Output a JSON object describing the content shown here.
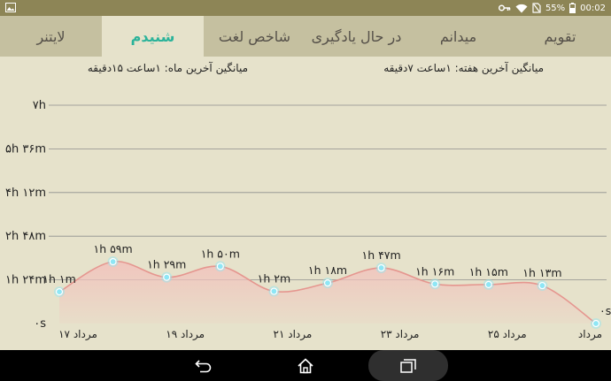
{
  "status_bar": {
    "battery": "55%",
    "time": "00:02",
    "icons": [
      "picture-icon",
      "key-icon",
      "wifi-icon",
      "no-sim-icon",
      "battery-icon"
    ]
  },
  "tabs": [
    {
      "label": "تقویم",
      "active": false
    },
    {
      "label": "میدانم",
      "active": false
    },
    {
      "label": "در حال یادگیری",
      "active": false
    },
    {
      "label": "شاخص لغت",
      "active": false
    },
    {
      "label": "شنیدم",
      "active": true
    },
    {
      "label": "لایتنر",
      "active": false
    }
  ],
  "stats": {
    "weekly_avg": "میانگین آخرین هفته: ۱ساعت  ۷دقیقه",
    "monthly_avg": "میانگین آخرین ماه: ۱ساعت  ۱۵دقیقه"
  },
  "chart_data": {
    "type": "area",
    "y_tick_labels": [
      "۰s",
      "۱h ۲۴m",
      "۲h ۴۸m",
      "۴h ۱۲m",
      "۵h ۳۶m",
      "۷h"
    ],
    "y_tick_values_minutes": [
      0,
      84,
      168,
      252,
      336,
      420
    ],
    "ylim_minutes": [
      0,
      420
    ],
    "x_tick_labels": [
      "۱۷ مرداد",
      "۱۹ مرداد",
      "۲۱ مرداد",
      "۲۳ مرداد",
      "۲۵ مرداد",
      "مرداد"
    ],
    "x_tick_indices": [
      0,
      2,
      4,
      6,
      8,
      10
    ],
    "points": [
      {
        "label": "۱h ۱m",
        "minutes": 61
      },
      {
        "label": "۱h ۵۹m",
        "minutes": 119
      },
      {
        "label": "۱h ۲۹m",
        "minutes": 89
      },
      {
        "label": "۱h ۵۰m",
        "minutes": 110
      },
      {
        "label": "۱h ۲m",
        "minutes": 62
      },
      {
        "label": "۱h ۱۸m",
        "minutes": 78
      },
      {
        "label": "۱h ۴۷m",
        "minutes": 107
      },
      {
        "label": "۱h ۱۶m",
        "minutes": 76
      },
      {
        "label": "۱h ۱۵m",
        "minutes": 75
      },
      {
        "label": "۱h ۱۳m",
        "minutes": 73
      },
      {
        "label": "۰s",
        "minutes": 0
      }
    ],
    "grid": true,
    "colors": {
      "line": "#e5968f",
      "fill": "#f1c4bd",
      "point": "#8ee6f5",
      "grid": "#8e8e8e"
    }
  },
  "nav_bar": {
    "buttons": [
      "back-icon",
      "home-icon",
      "recents-icon"
    ]
  }
}
